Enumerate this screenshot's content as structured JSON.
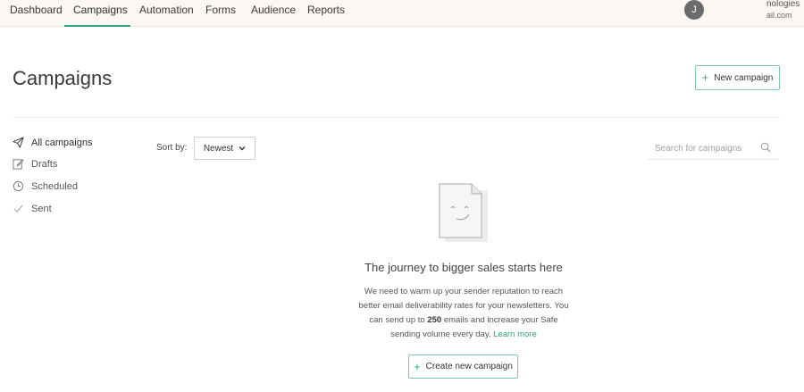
{
  "nav": {
    "items": [
      "Dashboard",
      "Campaigns",
      "Automation",
      "Forms",
      "Audience",
      "Reports"
    ],
    "active": "Campaigns"
  },
  "account": {
    "avatar_initial": "J",
    "name_partial": "nologies",
    "email_partial": "ail.com"
  },
  "page": {
    "title": "Campaigns",
    "new_campaign_label": "New campaign"
  },
  "sidebar": {
    "items": [
      {
        "label": "All campaigns",
        "icon": "paper-plane-icon"
      },
      {
        "label": "Drafts",
        "icon": "edit-icon"
      },
      {
        "label": "Scheduled",
        "icon": "clock-icon"
      },
      {
        "label": "Sent",
        "icon": "check-icon"
      }
    ]
  },
  "toolbar": {
    "sort_label": "Sort by:",
    "sort_value": "Newest",
    "search_placeholder": "Search for campaigns"
  },
  "empty_state": {
    "title": "The journey to bigger sales starts here",
    "desc_part1": "We need to warm up your sender reputation to reach better email deliverability rates for your newsletters. You can send up to",
    "desc_count": "250",
    "desc_part2": "emails and increase your Safe sending volume every day.",
    "learn_more": "Learn more",
    "create_label": "Create new campaign"
  },
  "colors": {
    "accent": "#2ea47f",
    "topbar_bg": "#fbf7f3"
  }
}
